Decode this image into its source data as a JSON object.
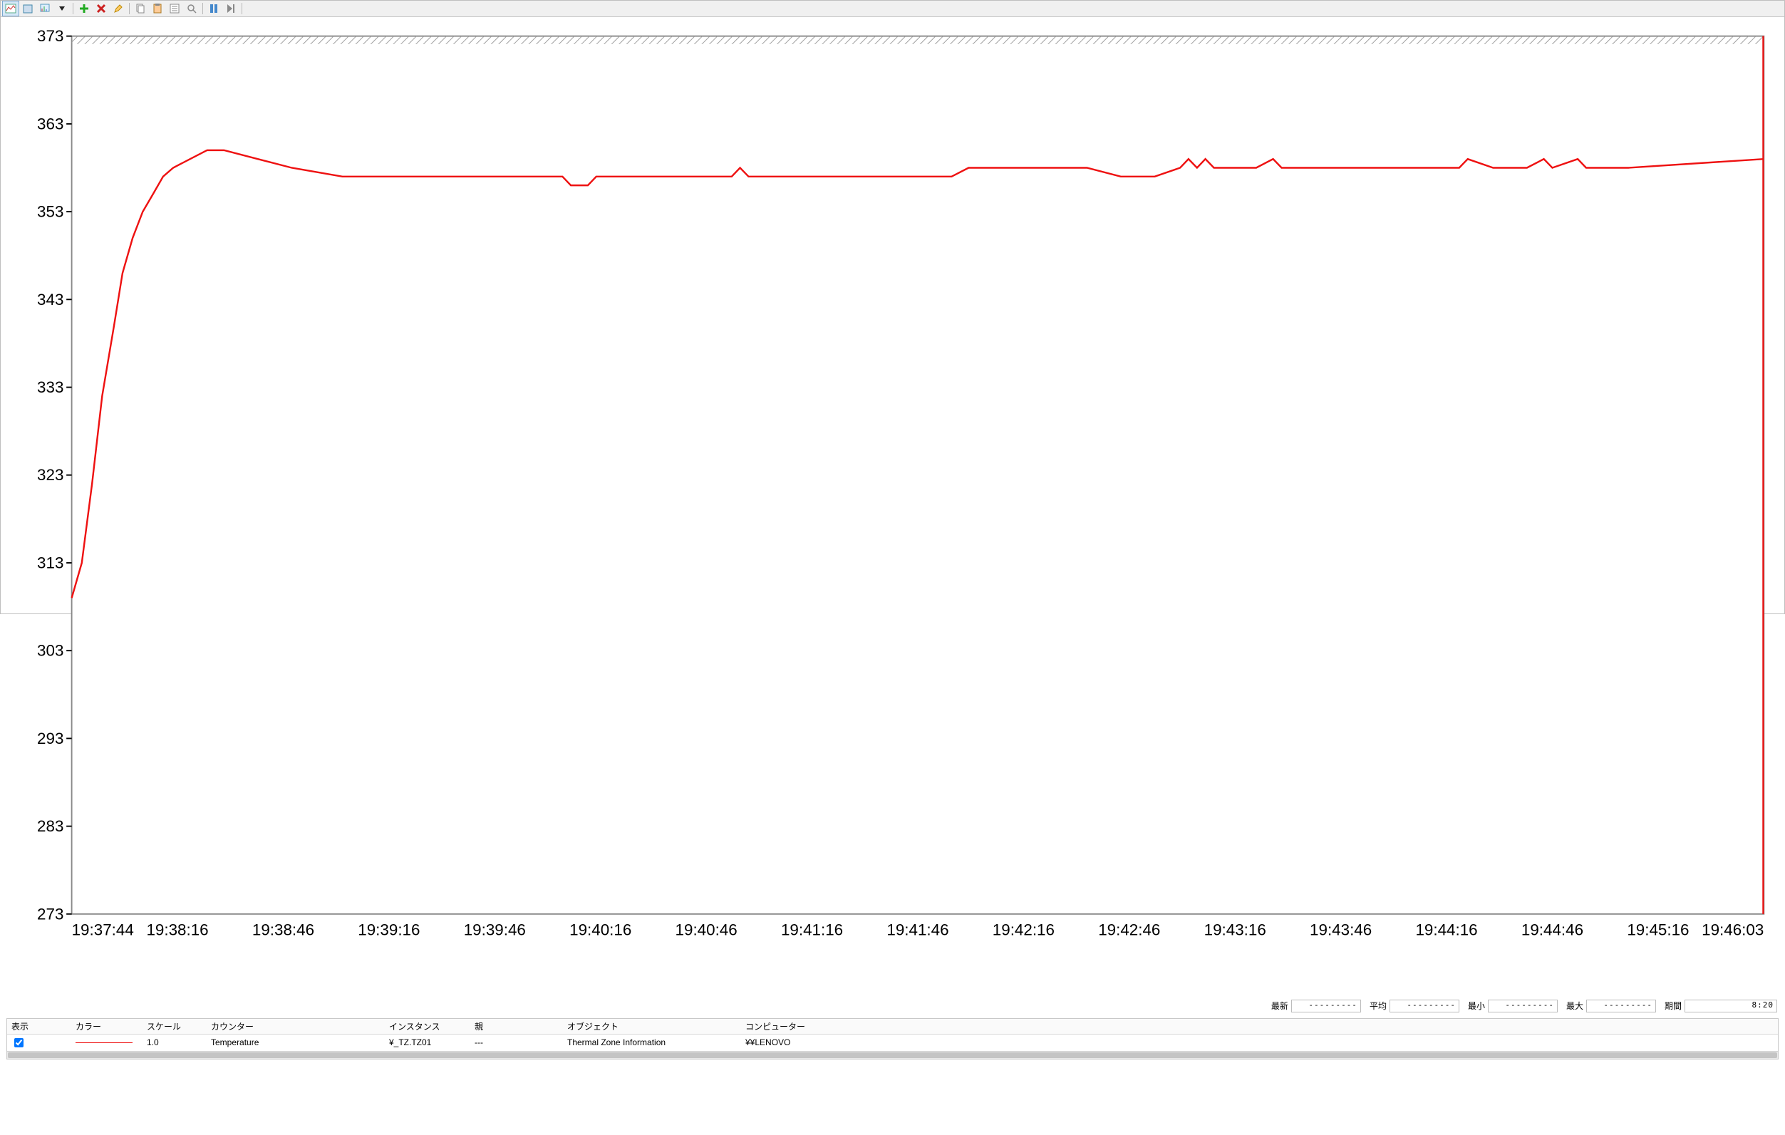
{
  "toolbar": {
    "buttons": [
      {
        "name": "view-line-chart-icon"
      },
      {
        "name": "view-histogram-icon"
      },
      {
        "name": "view-report-icon"
      },
      {
        "name": "dropdown-icon"
      },
      {
        "sep": true
      },
      {
        "name": "add-counter-icon"
      },
      {
        "name": "remove-counter-icon"
      },
      {
        "name": "highlight-icon"
      },
      {
        "sep": true
      },
      {
        "name": "copy-icon"
      },
      {
        "name": "paste-icon"
      },
      {
        "name": "properties-icon"
      },
      {
        "name": "zoom-icon"
      },
      {
        "sep": true
      },
      {
        "name": "freeze-display-icon"
      },
      {
        "name": "update-data-icon"
      }
    ]
  },
  "chart_data": {
    "type": "line",
    "ylim": [
      273,
      373
    ],
    "y_ticks": [
      273,
      283,
      293,
      303,
      313,
      323,
      333,
      343,
      353,
      363,
      373
    ],
    "x_ticks": [
      "19:37:44",
      "19:38:16",
      "19:38:46",
      "19:39:16",
      "19:39:46",
      "19:40:16",
      "19:40:46",
      "19:41:16",
      "19:41:46",
      "19:42:16",
      "19:42:46",
      "19:43:16",
      "19:43:46",
      "19:44:16",
      "19:44:46",
      "19:45:16",
      "19:46:03"
    ],
    "series": [
      {
        "name": "Temperature",
        "color": "#e11",
        "points": [
          [
            0,
            309
          ],
          [
            0.6,
            313
          ],
          [
            1.2,
            322
          ],
          [
            1.8,
            332
          ],
          [
            2.5,
            340
          ],
          [
            3,
            346
          ],
          [
            3.6,
            350
          ],
          [
            4.2,
            353
          ],
          [
            4.8,
            355
          ],
          [
            5.4,
            357
          ],
          [
            6,
            358
          ],
          [
            7,
            359
          ],
          [
            8,
            360
          ],
          [
            9,
            360
          ],
          [
            11,
            359
          ],
          [
            13,
            358
          ],
          [
            16,
            357
          ],
          [
            19,
            357
          ],
          [
            23,
            357
          ],
          [
            27,
            357
          ],
          [
            29,
            357
          ],
          [
            29.5,
            356
          ],
          [
            30.5,
            356
          ],
          [
            31,
            357
          ],
          [
            33,
            357
          ],
          [
            34,
            357
          ],
          [
            39,
            357
          ],
          [
            39.5,
            358
          ],
          [
            40,
            357
          ],
          [
            45,
            357
          ],
          [
            48,
            357
          ],
          [
            52,
            357
          ],
          [
            53,
            358
          ],
          [
            56,
            358
          ],
          [
            60,
            358
          ],
          [
            62,
            357
          ],
          [
            64,
            357
          ],
          [
            65.5,
            358
          ],
          [
            66,
            359
          ],
          [
            66.5,
            358
          ],
          [
            67,
            359
          ],
          [
            67.5,
            358
          ],
          [
            70,
            358
          ],
          [
            71,
            359
          ],
          [
            71.5,
            358
          ],
          [
            76,
            358
          ],
          [
            82,
            358
          ],
          [
            82.5,
            359
          ],
          [
            84,
            358
          ],
          [
            86,
            358
          ],
          [
            87,
            359
          ],
          [
            87.5,
            358
          ],
          [
            89,
            359
          ],
          [
            89.5,
            358
          ],
          [
            92,
            358
          ],
          [
            100,
            359
          ]
        ]
      }
    ]
  },
  "stats": {
    "labels": {
      "last": "最新",
      "avg": "平均",
      "min": "最小",
      "max": "最大",
      "duration": "期間"
    },
    "values": {
      "last": "---------",
      "avg": "---------",
      "min": "---------",
      "max": "---------",
      "duration": "8:20"
    }
  },
  "counter_table": {
    "headers": {
      "show": "表示",
      "color": "カラー",
      "scale": "スケール",
      "counter": "カウンター",
      "instance": "インスタンス",
      "parent": "親",
      "object": "オブジェクト",
      "computer": "コンピューター"
    },
    "rows": [
      {
        "show": true,
        "color": "#e11",
        "scale": "1.0",
        "counter": "Temperature",
        "instance": "¥_TZ.TZ01",
        "parent": "---",
        "object": "Thermal Zone Information",
        "computer": "¥¥LENOVO"
      }
    ]
  }
}
